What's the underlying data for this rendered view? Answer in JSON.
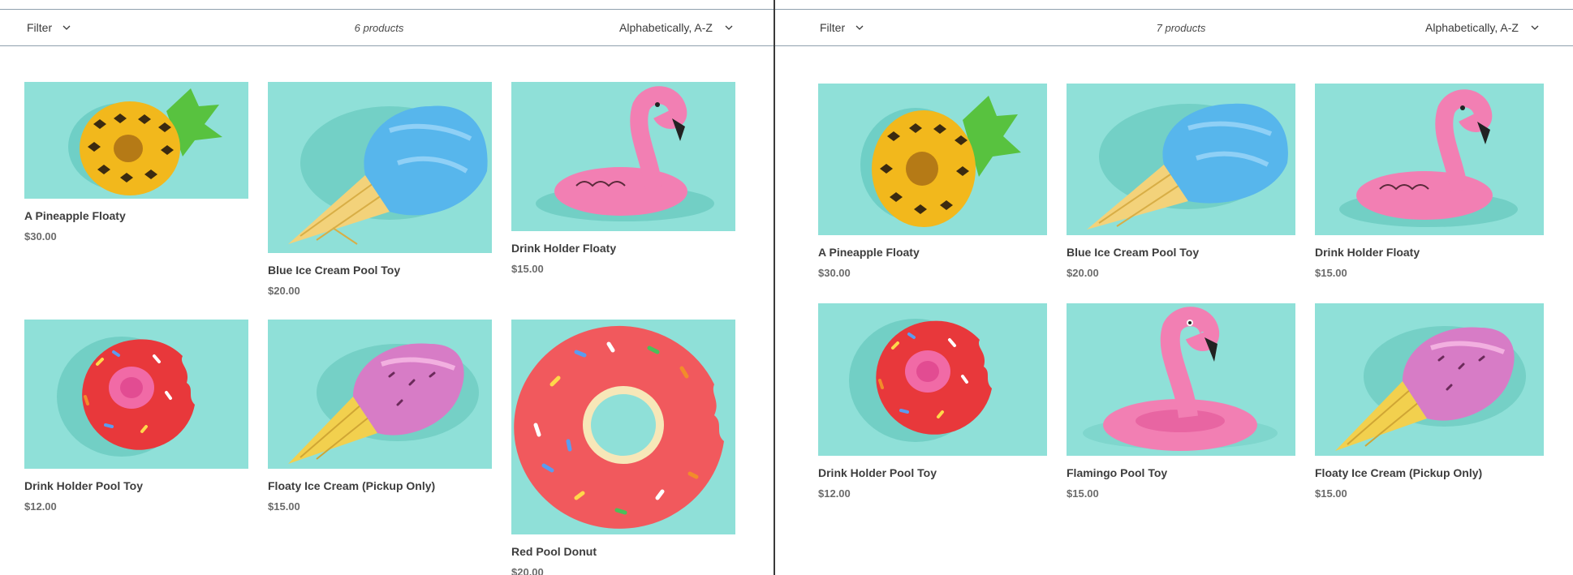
{
  "left": {
    "filter_label": "Filter",
    "count": "6 products",
    "sort_label": "Alphabetically, A-Z",
    "products": [
      {
        "title": "A Pineapple Floaty",
        "price": "$30.00",
        "image": "pineapple-floaty-icon"
      },
      {
        "title": "Blue Ice Cream Pool Toy",
        "price": "$20.00",
        "image": "blue-ice-cream-icon"
      },
      {
        "title": "Drink Holder Floaty",
        "price": "$15.00",
        "image": "flamingo-drink-holder-icon"
      },
      {
        "title": "Drink Holder Pool Toy",
        "price": "$12.00",
        "image": "donut-drink-holder-icon"
      },
      {
        "title": "Floaty Ice Cream (Pickup Only)",
        "price": "$15.00",
        "image": "pink-ice-cream-icon"
      },
      {
        "title": "Red Pool Donut",
        "price": "$20.00",
        "image": "red-donut-icon"
      }
    ]
  },
  "right": {
    "filter_label": "Filter",
    "count": "7 products",
    "sort_label": "Alphabetically, A-Z",
    "products": [
      {
        "title": "A Pineapple Floaty",
        "price": "$30.00",
        "image": "pineapple-floaty-icon"
      },
      {
        "title": "Blue Ice Cream Pool Toy",
        "price": "$20.00",
        "image": "blue-ice-cream-icon"
      },
      {
        "title": "Drink Holder Floaty",
        "price": "$15.00",
        "image": "flamingo-drink-holder-icon"
      },
      {
        "title": "Drink Holder Pool Toy",
        "price": "$12.00",
        "image": "donut-drink-holder-icon"
      },
      {
        "title": "Flamingo Pool Toy",
        "price": "$15.00",
        "image": "flamingo-pool-toy-icon"
      },
      {
        "title": "Floaty Ice Cream (Pickup Only)",
        "price": "$15.00",
        "image": "pink-ice-cream-icon"
      }
    ]
  },
  "colors": {
    "image_bg": "#8fe0d8",
    "divider": "#3a3a3a",
    "toolbar_rule": "#8fa0ad"
  }
}
